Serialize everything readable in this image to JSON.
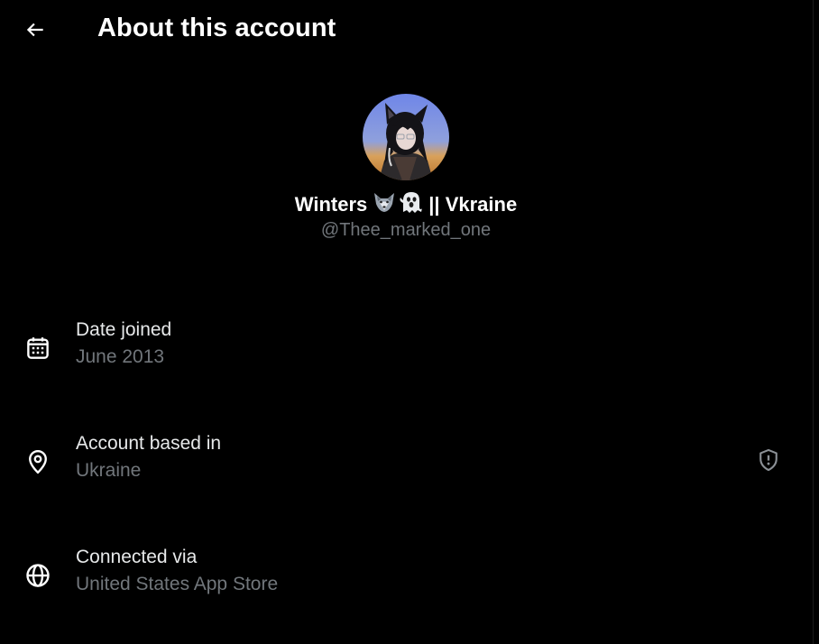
{
  "header": {
    "back_icon": "arrow-left-icon",
    "title": "About this account"
  },
  "profile": {
    "display_name_prefix": "Winters",
    "display_name_emojis": [
      "wolf-emoji-icon",
      "ghost-emoji-icon"
    ],
    "display_name_suffix": "|| Vkraine",
    "handle": "@Thee_marked_one"
  },
  "rows": [
    {
      "icon": "calendar-icon",
      "label": "Date joined",
      "value": "June 2013"
    },
    {
      "icon": "location-pin-icon",
      "label": "Account based in",
      "value": "Ukraine",
      "trailing_icon": "shield-alert-icon"
    },
    {
      "icon": "globe-icon",
      "label": "Connected via",
      "value": "United States App Store"
    }
  ],
  "colors": {
    "background": "#000000",
    "primary_text": "#e7e9ea",
    "secondary_text": "#71767b"
  }
}
